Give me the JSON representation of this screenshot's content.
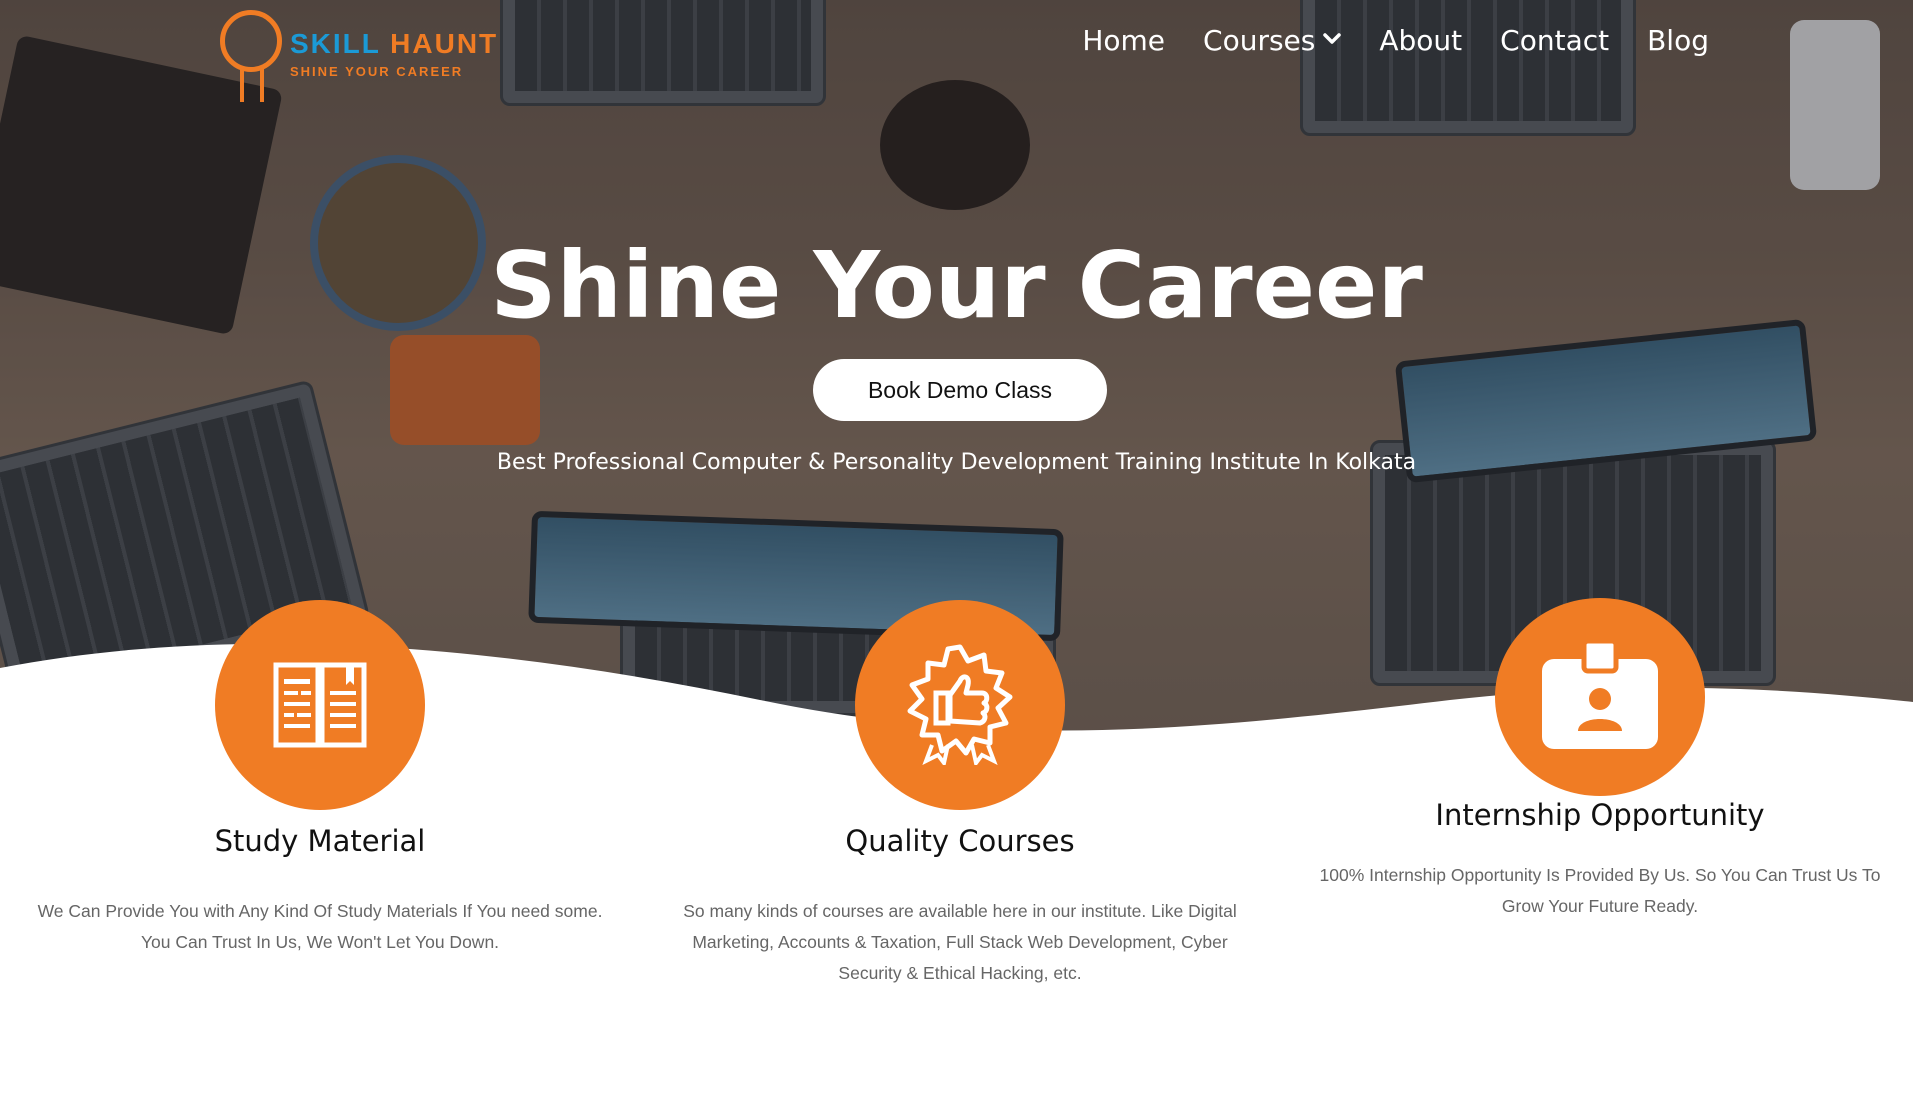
{
  "brand": {
    "name_part1": "SKILL",
    "name_part2": "HAUNT",
    "tagline": "SHINE YOUR CAREER"
  },
  "nav": {
    "items": [
      {
        "label": "Home"
      },
      {
        "label": "Courses",
        "has_dropdown": true
      },
      {
        "label": "About"
      },
      {
        "label": "Contact"
      },
      {
        "label": "Blog"
      }
    ]
  },
  "hero": {
    "title": "Shine Your Career",
    "button_label": "Book Demo Class",
    "subtitle": "Best Professional Computer & Personality Development Training Institute In Kolkata"
  },
  "features": [
    {
      "icon": "open-book-icon",
      "title": "Study Material",
      "description": "We Can Provide You with Any Kind Of Study Materials If You need some. You Can Trust In Us, We Won't Let You Down."
    },
    {
      "icon": "quality-badge-icon",
      "title": "Quality Courses",
      "description": "So many kinds of courses are available here in our institute. Like Digital Marketing, Accounts & Taxation, Full Stack Web Development, Cyber Security & Ethical Hacking, etc."
    },
    {
      "icon": "id-badge-icon",
      "title": "Internship Opportunity",
      "description": "100% Internship Opportunity Is Provided By Us. So You Can Trust Us To Grow Your Future Ready."
    }
  ],
  "colors": {
    "accent": "#f07c24",
    "brand_blue": "#1b9ad6",
    "body_text": "#666666"
  }
}
